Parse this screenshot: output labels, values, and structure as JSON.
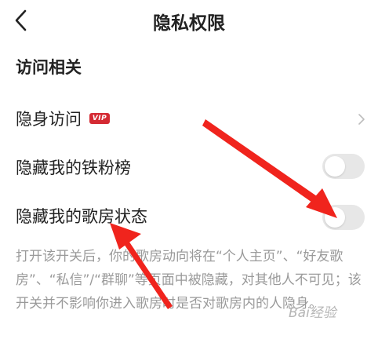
{
  "header": {
    "title": "隐私权限"
  },
  "section": {
    "title": "访问相关"
  },
  "rows": [
    {
      "label": "隐身访问",
      "badge": "VIP"
    },
    {
      "label": "隐藏我的铁粉榜",
      "toggle_on": false
    },
    {
      "label": "隐藏我的歌房状态",
      "toggle_on": false
    }
  ],
  "description": "打开该开关后，你的歌房动向将在“个人主页”、“好友歌房”、“私信”/“群聊”等页面中被隐藏，对其他人不可见；该开关并不影响你进入歌房时是否对歌房内的人隐身。",
  "annotation": {
    "arrow_color": "#f0241d"
  },
  "watermark": "Bai经验"
}
